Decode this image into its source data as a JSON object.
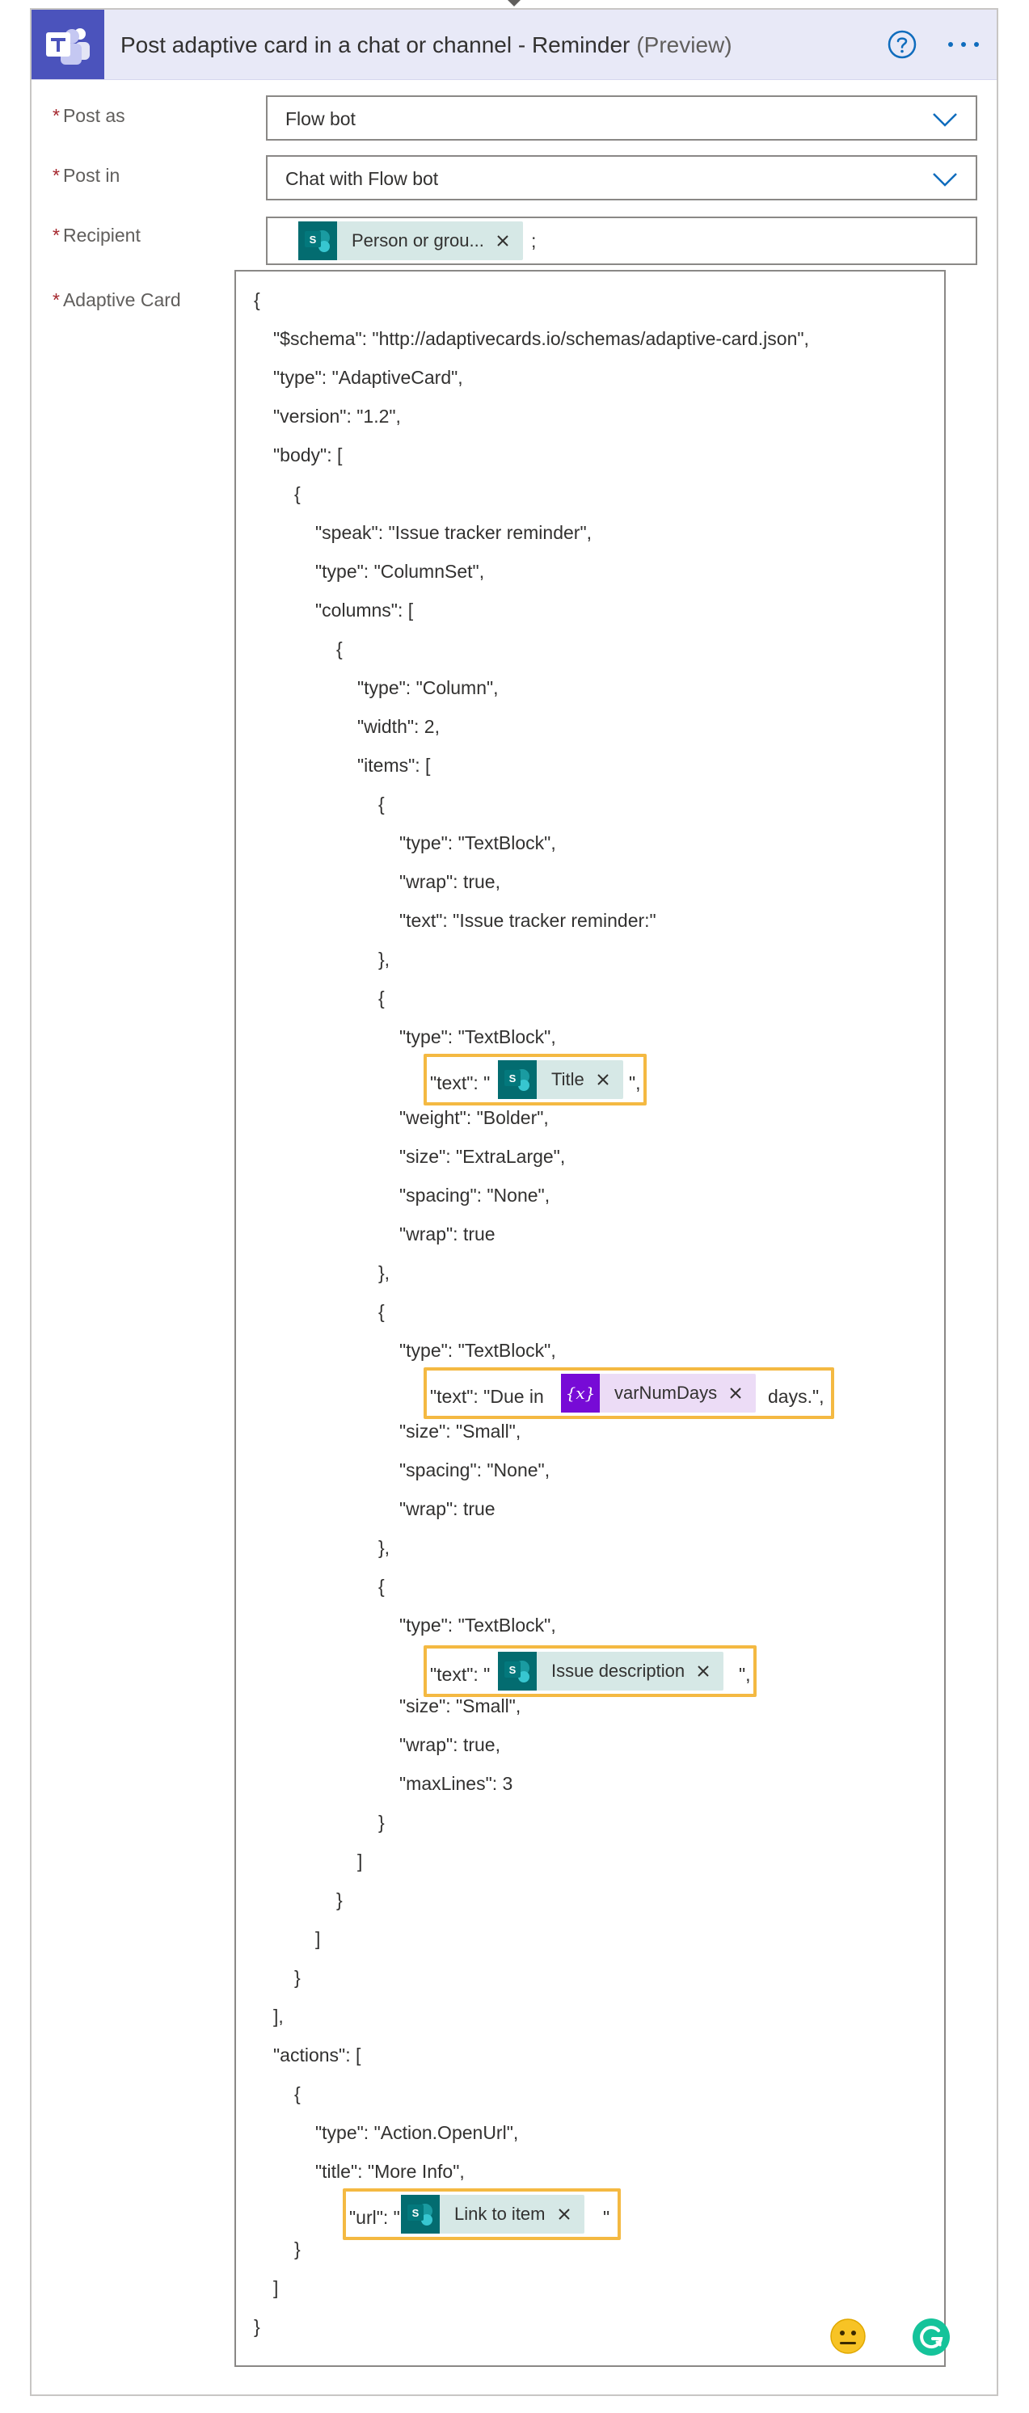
{
  "header": {
    "title": "Post adaptive card in a chat or channel - Reminder",
    "suffix": "(Preview)",
    "app_icon": "microsoft-teams-icon",
    "help_icon": "question-circle-icon",
    "more_icon": "ellipsis-icon",
    "header_bg": "#e8e9f7",
    "brand_color": "#4b53bc"
  },
  "fields": {
    "required_mark": "*",
    "post_as": {
      "label": "Post as",
      "value": "Flow bot"
    },
    "post_in": {
      "label": "Post in",
      "value": "Chat with Flow bot"
    },
    "recipient": {
      "label": "Recipient",
      "token": "Person or grou...",
      "separator": ";"
    },
    "adaptive_card": {
      "label": "Adaptive Card"
    }
  },
  "editor": {
    "lines": [
      "{",
      "\"$schema\": \"http://adaptivecards.io/schemas/adaptive-card.json\",",
      "\"type\": \"AdaptiveCard\",",
      "\"version\": \"1.2\",",
      "\"body\": [",
      "{",
      "\"speak\": \"Issue tracker reminder\",",
      "\"type\": \"ColumnSet\",",
      "\"columns\": [",
      "{",
      "\"type\": \"Column\",",
      "\"width\": 2,",
      "\"items\": [",
      "{",
      "\"type\": \"TextBlock\",",
      "\"wrap\": true,",
      "\"text\": \"Issue tracker reminder:\"",
      "},",
      "{",
      "\"type\": \"TextBlock\",",
      "\"weight\": \"Bolder\",",
      "\"size\": \"ExtraLarge\",",
      "\"spacing\": \"None\",",
      "\"wrap\": true",
      "},",
      "{",
      "\"type\": \"TextBlock\",",
      "\"size\": \"Small\",",
      "\"spacing\": \"None\",",
      "\"wrap\": true",
      "},",
      "{",
      "\"type\": \"TextBlock\",",
      "\"size\": \"Small\",",
      "\"wrap\": true,",
      "\"maxLines\": 3",
      "}",
      "]",
      "}",
      "]",
      "}",
      "],",
      "\"actions\": [",
      "{",
      "\"type\": \"Action.OpenUrl\",",
      "\"title\": \"More Info\",",
      "}",
      "]",
      "}"
    ],
    "token_lines": {
      "title": {
        "prefix": "\"text\": \"",
        "token": "Title",
        "suffix": "\","
      },
      "due": {
        "prefix": "\"text\": \"Due in",
        "token": "varNumDays",
        "suffix": "days.\","
      },
      "description": {
        "prefix": "\"text\": \"",
        "token": "Issue description",
        "suffix": "\","
      },
      "url": {
        "prefix": "\"url\": \"",
        "token": "Link to item",
        "suffix": "\""
      }
    },
    "highlight_color": "#f4b942",
    "sharepoint_token_color": "#d6e8e6",
    "variable_token_color": "#ecdcf6",
    "sharepoint_icon": "sharepoint-icon",
    "variable_icon": "variable-icon",
    "emoji_icon": "neutral-face-icon",
    "grammarly_icon": "grammarly-icon"
  }
}
